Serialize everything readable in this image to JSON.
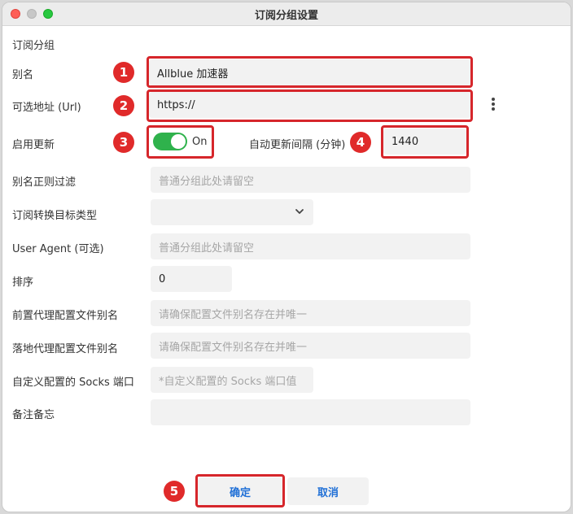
{
  "window": {
    "title": "订阅分组设置"
  },
  "group_label": "订阅分组",
  "fields": {
    "alias": {
      "label": "别名",
      "value": "Allblue 加速器"
    },
    "url": {
      "label": "可选地址 (Url)",
      "value": "https://"
    },
    "auto_update": {
      "label": "启用更新",
      "toggle_state": "On",
      "enabled": true
    },
    "interval": {
      "label": "自动更新间隔 (分钟)",
      "value": "1440"
    },
    "alias_regex": {
      "label": "别名正则过滤",
      "placeholder": "普通分组此处请留空"
    },
    "convert_target": {
      "label": "订阅转换目标类型",
      "value": ""
    },
    "user_agent": {
      "label": "User Agent (可选)",
      "placeholder": "普通分组此处请留空"
    },
    "sort": {
      "label": "排序",
      "value": "0"
    },
    "prev_proxy": {
      "label": "前置代理配置文件别名",
      "placeholder": "请确保配置文件别名存在并唯一"
    },
    "next_proxy": {
      "label": "落地代理配置文件别名",
      "placeholder": "请确保配置文件别名存在并唯一"
    },
    "socks_port": {
      "label": "自定义配置的 Socks 端口",
      "placeholder": "*自定义配置的 Socks 端口值"
    },
    "memo": {
      "label": "备注备忘",
      "value": ""
    }
  },
  "annotations": [
    "1",
    "2",
    "3",
    "4",
    "5"
  ],
  "buttons": {
    "confirm": "确定",
    "cancel": "取消"
  },
  "colors": {
    "highlight": "#d6262b",
    "toggle_on": "#2fb24c",
    "button_text": "#1f6fd6"
  }
}
